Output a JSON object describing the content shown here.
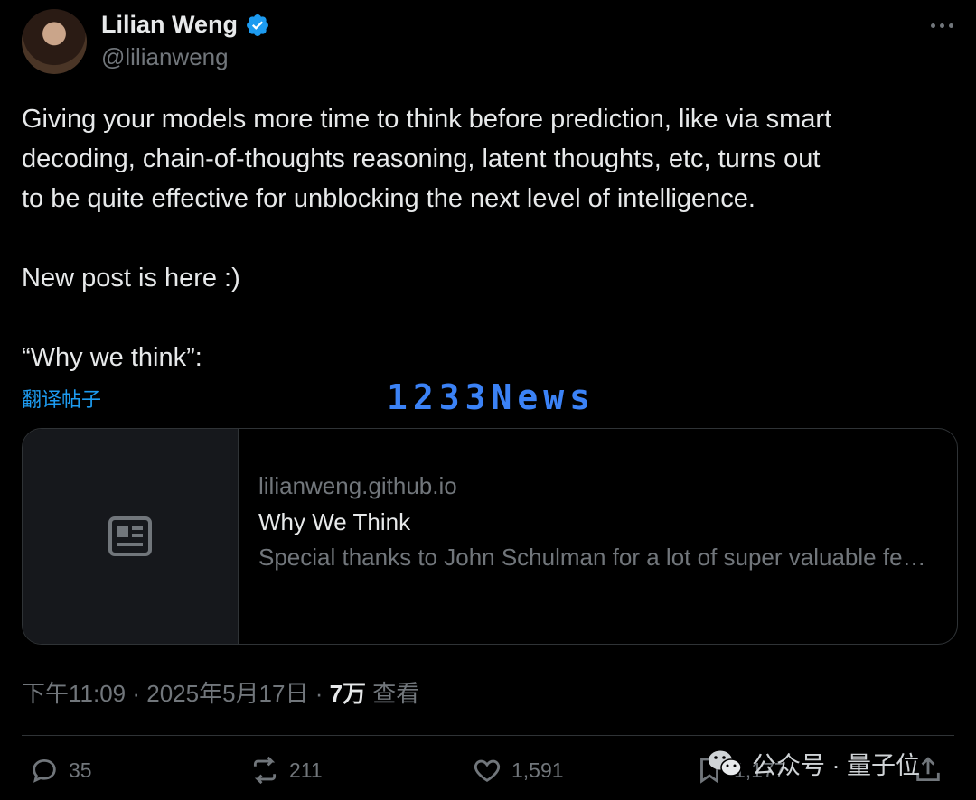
{
  "author": {
    "name": "Lilian Weng",
    "handle": "@lilianweng"
  },
  "tweet": {
    "text": "Giving your models more time to think before prediction, like via smart\ndecoding, chain-of-thoughts reasoning, latent thoughts, etc, turns out\nto be quite effective for unblocking the next level of intelligence.\n\nNew post is here :)\n\n“Why we think”:",
    "translate_label": "翻译帖子"
  },
  "watermark": "1233News",
  "card": {
    "domain": "lilianweng.github.io",
    "title": "Why We Think",
    "description": "Special thanks to John Schulman for a lot of super valuable feedback and direct edits on this post. Test time compute..."
  },
  "meta": {
    "time": "下午11:09",
    "sep1": " · ",
    "date": "2025年5月17日",
    "sep2": " · ",
    "views": "7万",
    "views_label": " 查看"
  },
  "actions": {
    "replies": "35",
    "reposts": "211",
    "likes": "1,591",
    "bookmarks": "1,177"
  },
  "footer_watermark": "公众号 · 量子位",
  "colors": {
    "accent": "#1d9bf0",
    "muted": "#71767b",
    "text": "#e7e9ea",
    "background": "#000000"
  },
  "icons": [
    "verified-badge-icon",
    "more-icon",
    "article-icon",
    "reply-icon",
    "repost-icon",
    "like-icon",
    "bookmark-icon",
    "share-icon",
    "wechat-icon"
  ]
}
